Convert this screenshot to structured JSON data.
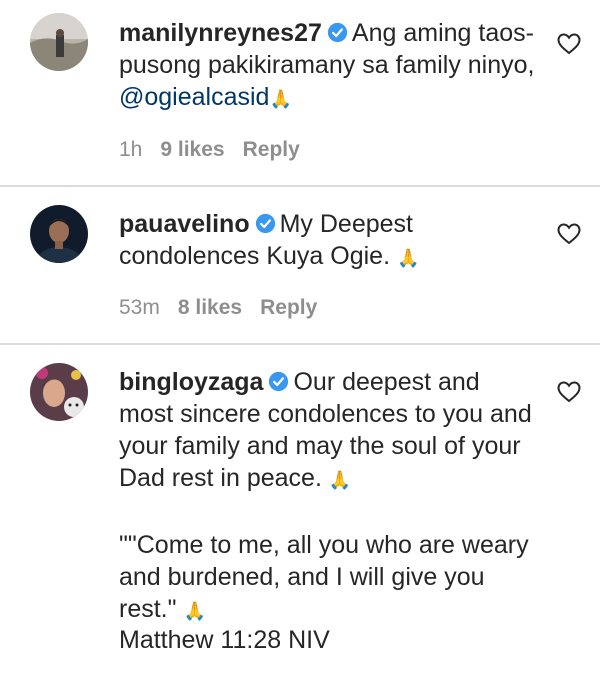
{
  "comments": [
    {
      "username": "manilynreynes27",
      "text_before": "Ang aming taos-pusong pakikiramany sa family ninyo, ",
      "mention": "@ogiealcasid",
      "emoji": "🙏",
      "time": "1h",
      "likes": "9 likes",
      "reply": "Reply"
    },
    {
      "username": "pauavelino",
      "text": "My Deepest condolences Kuya Ogie. ",
      "emoji": "🙏",
      "time": "53m",
      "likes": "8 likes",
      "reply": "Reply"
    },
    {
      "username": "bingloyzaga",
      "text": "Our deepest and most sincere condolences to you and your family and may the soul of your Dad rest in peace. ",
      "emoji": "🙏",
      "quote_text": "\"\"Come to me, all you who are weary and burdened, and I will give you rest.\" ",
      "quote_emoji": "🙏",
      "reference": "Matthew 11:28 NIV"
    }
  ],
  "colors": {
    "verified_badge": "#3897f0",
    "mention": "#00376b",
    "meta_text": "#8e8e8e"
  },
  "icons": {
    "verified": "verified-badge-icon",
    "like": "heart-outline-icon"
  }
}
